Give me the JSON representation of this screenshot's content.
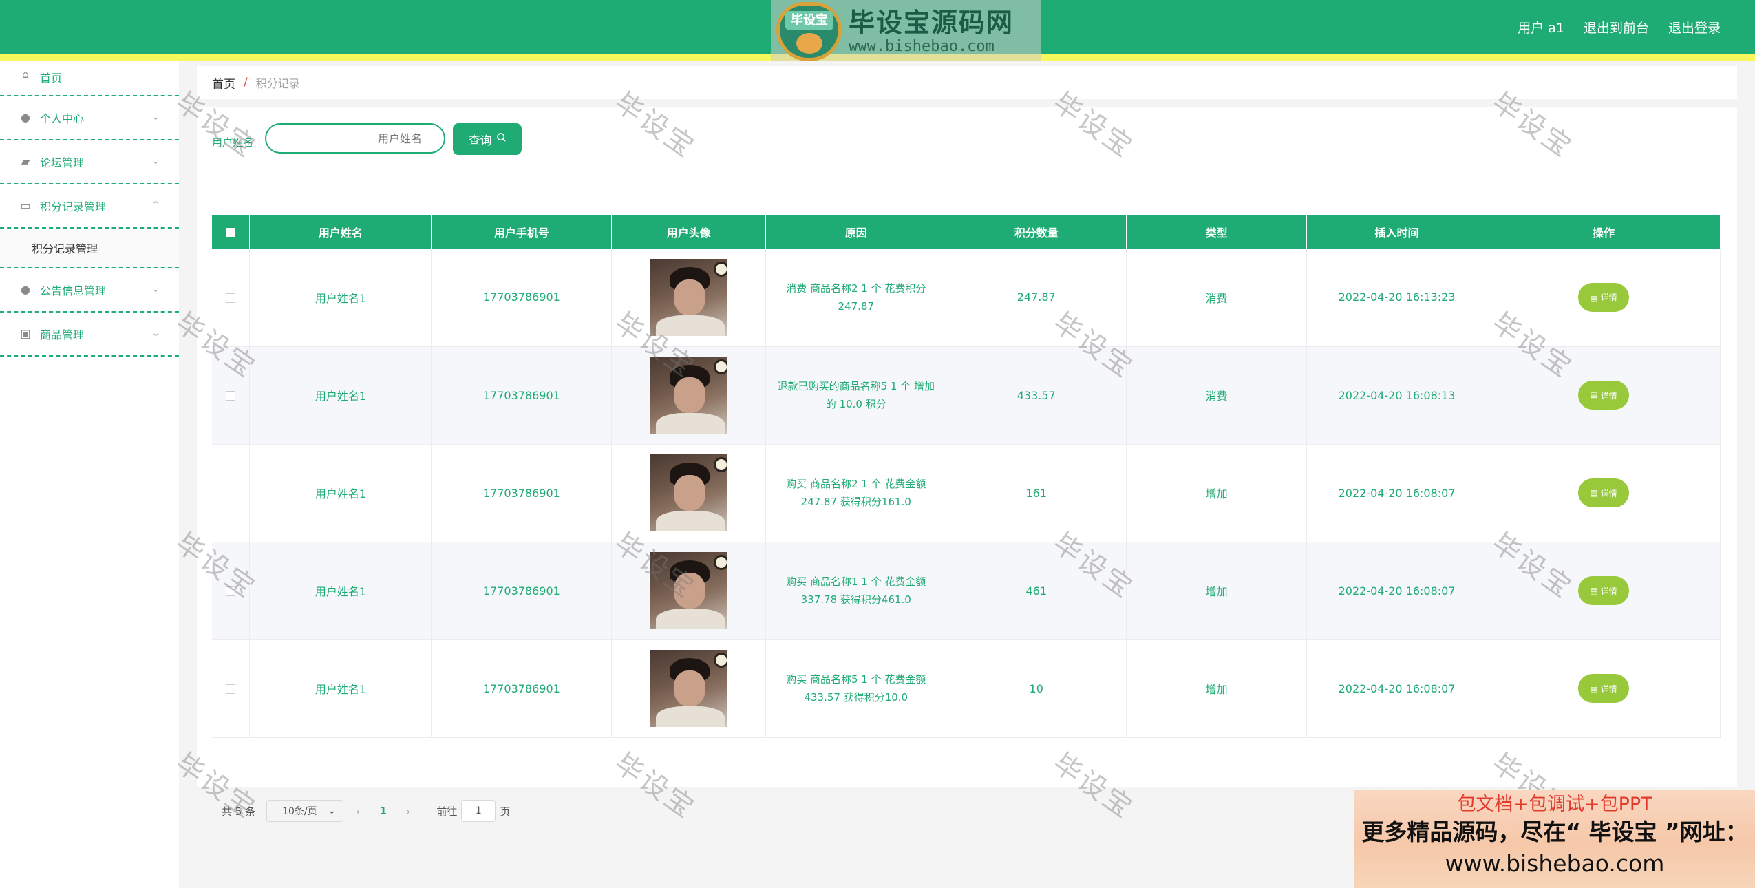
{
  "header": {
    "user_label": "用户 a1",
    "front_link": "退出到前台",
    "logout_link": "退出登录",
    "watermark_logo": {
      "badge": "毕设宝",
      "title": "毕设宝源码网",
      "url": "www.bishebao.com"
    }
  },
  "sidebar": {
    "items": [
      {
        "label": "首页",
        "icon": "home-icon"
      },
      {
        "label": "个人中心",
        "icon": "user-icon"
      },
      {
        "label": "论坛管理",
        "icon": "forum-icon"
      },
      {
        "label": "积分记录管理",
        "icon": "record-icon"
      },
      {
        "label": "公告信息管理",
        "icon": "notice-icon"
      },
      {
        "label": "商品管理",
        "icon": "goods-icon"
      }
    ],
    "submenu": {
      "label": "积分记录管理"
    }
  },
  "breadcrumb": {
    "home": "首页",
    "separator": "/",
    "current": "积分记录"
  },
  "search": {
    "label": "用户姓名",
    "placeholder": "用户姓名",
    "button_label": "查询"
  },
  "table": {
    "columns": [
      "用户姓名",
      "用户手机号",
      "用户头像",
      "原因",
      "积分数量",
      "类型",
      "插入时间",
      "操作"
    ],
    "rows": [
      {
        "name": "用户姓名1",
        "phone": "17703786901",
        "reason": "消费 商品名称2 1 个 花费积分 247.87",
        "points": "247.87",
        "type": "消费",
        "time": "2022-04-20 16:13:23",
        "action": "详情"
      },
      {
        "name": "用户姓名1",
        "phone": "17703786901",
        "reason": "退款已购买的商品名称5 1 个 增加的 10.0 积分",
        "points": "433.57",
        "type": "消费",
        "time": "2022-04-20 16:08:13",
        "action": "详情"
      },
      {
        "name": "用户姓名1",
        "phone": "17703786901",
        "reason": "购买 商品名称2 1 个 花费金额 247.87 获得积分161.0",
        "points": "161",
        "type": "增加",
        "time": "2022-04-20 16:08:07",
        "action": "详情"
      },
      {
        "name": "用户姓名1",
        "phone": "17703786901",
        "reason": "购买 商品名称1 1 个 花费金额 337.78 获得积分461.0",
        "points": "461",
        "type": "增加",
        "time": "2022-04-20 16:08:07",
        "action": "详情"
      },
      {
        "name": "用户姓名1",
        "phone": "17703786901",
        "reason": "购买 商品名称5 1 个 花费金额 433.57 获得积分10.0",
        "points": "10",
        "type": "增加",
        "time": "2022-04-20 16:08:07",
        "action": "详情"
      }
    ]
  },
  "pagination": {
    "total": "共 5 条",
    "page_size": "10条/页",
    "current_page": "1",
    "goto_label": "前往",
    "goto_value": "1",
    "page_unit": "页"
  },
  "watermark_text": "毕设宝",
  "ad": {
    "line1": "包文档+包调试+包PPT",
    "line2": "更多精品源码，尽在“ 毕设宝 ”网址：",
    "line3": "www.bishebao.com"
  },
  "colors": {
    "primary": "#1fab74",
    "accent_stripe": "#f6f75a",
    "detail_button": "#98c93a"
  }
}
